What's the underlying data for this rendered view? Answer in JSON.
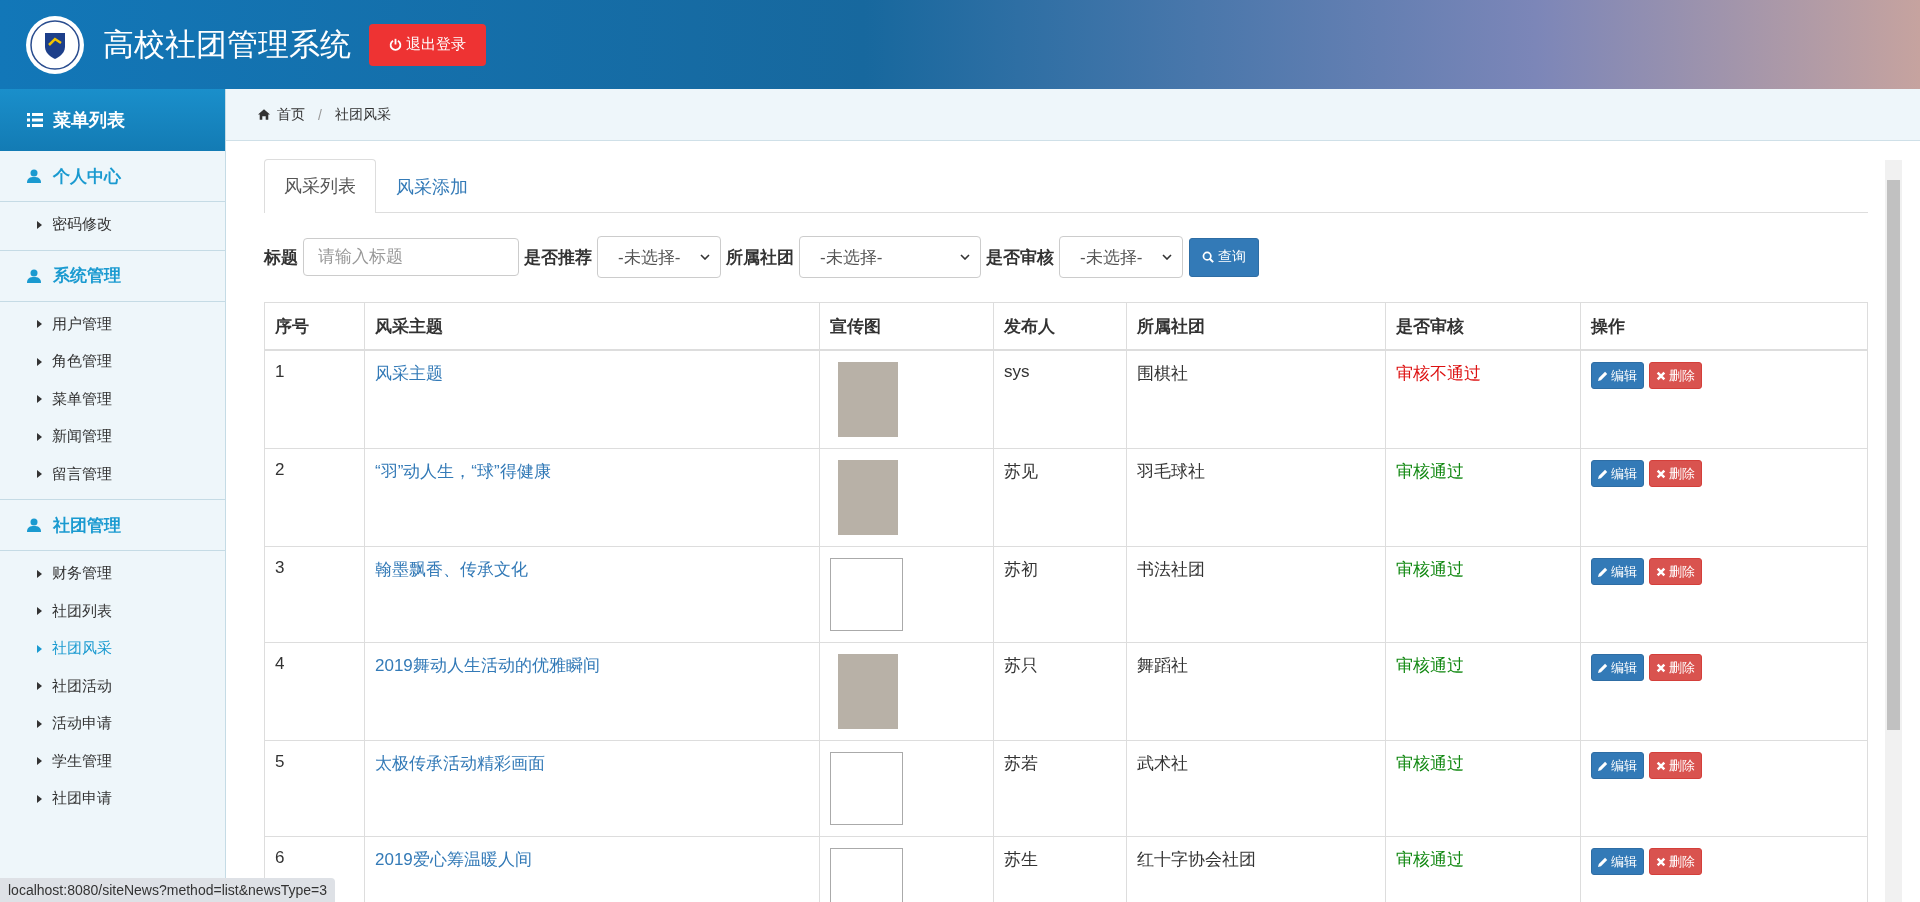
{
  "header": {
    "title": "高校社团管理系统",
    "logout": "退出登录"
  },
  "sidebar": {
    "title": "菜单列表",
    "groups": [
      {
        "label": "个人中心",
        "items": [
          {
            "label": "密码修改",
            "selected": false
          }
        ]
      },
      {
        "label": "系统管理",
        "items": [
          {
            "label": "用户管理",
            "selected": false
          },
          {
            "label": "角色管理",
            "selected": false
          },
          {
            "label": "菜单管理",
            "selected": false
          },
          {
            "label": "新闻管理",
            "selected": false
          },
          {
            "label": "留言管理",
            "selected": false
          }
        ]
      },
      {
        "label": "社团管理",
        "items": [
          {
            "label": "财务管理",
            "selected": false
          },
          {
            "label": "社团列表",
            "selected": false
          },
          {
            "label": "社团风采",
            "selected": true
          },
          {
            "label": "社团活动",
            "selected": false
          },
          {
            "label": "活动申请",
            "selected": false
          },
          {
            "label": "学生管理",
            "selected": false
          },
          {
            "label": "社团申请",
            "selected": false
          }
        ]
      }
    ]
  },
  "breadcrumb": {
    "home": "首页",
    "separator": "/",
    "current": "社团风采"
  },
  "tabs": [
    {
      "label": "风采列表",
      "selected": true
    },
    {
      "label": "风采添加",
      "selected": false
    }
  ],
  "filters": {
    "title_label": "标题",
    "title_placeholder": "请输入标题",
    "selects": [
      {
        "label": "是否推荐",
        "value": "-未选择-"
      },
      {
        "label": "所属社团",
        "value": "-未选择-"
      },
      {
        "label": "是否审核",
        "value": "-未选择-"
      }
    ],
    "search": "查询"
  },
  "table": {
    "columns": [
      "序号",
      "风采主题",
      "宣传图",
      "发布人",
      "所属社团",
      "是否审核",
      "操作"
    ],
    "rows": [
      {
        "no": "1",
        "topic": "风采主题",
        "kind": "photo",
        "author": "sys",
        "club": "围棋社",
        "status": "审核不通过",
        "approved": false,
        "edit": "编辑",
        "delete": "删除"
      },
      {
        "no": "2",
        "topic": "“羽”动人生，“球”得健康",
        "kind": "photo",
        "author": "苏见",
        "club": "羽毛球社",
        "status": "审核通过",
        "approved": true,
        "edit": "编辑",
        "delete": "删除"
      },
      {
        "no": "3",
        "topic": "翰墨飘香、传承文化",
        "kind": "broken",
        "author": "苏初",
        "club": "书法社团",
        "status": "审核通过",
        "approved": true,
        "edit": "编辑",
        "delete": "删除"
      },
      {
        "no": "4",
        "topic": "2019舞动人生活动的优雅瞬间",
        "kind": "photo",
        "author": "苏只",
        "club": "舞蹈社",
        "status": "审核通过",
        "approved": true,
        "edit": "编辑",
        "delete": "删除"
      },
      {
        "no": "5",
        "topic": "太极传承活动精彩画面",
        "kind": "broken",
        "author": "苏若",
        "club": "武术社",
        "status": "审核通过",
        "approved": true,
        "edit": "编辑",
        "delete": "删除"
      },
      {
        "no": "6",
        "topic": "2019爱心筹温暖人间",
        "kind": "broken",
        "author": "苏生",
        "club": "红十字协会社团",
        "status": "审核通过",
        "approved": true,
        "edit": "编辑",
        "delete": "删除"
      }
    ]
  },
  "status_bar": "localhost:8080/siteNews?method=list&newsType=3"
}
